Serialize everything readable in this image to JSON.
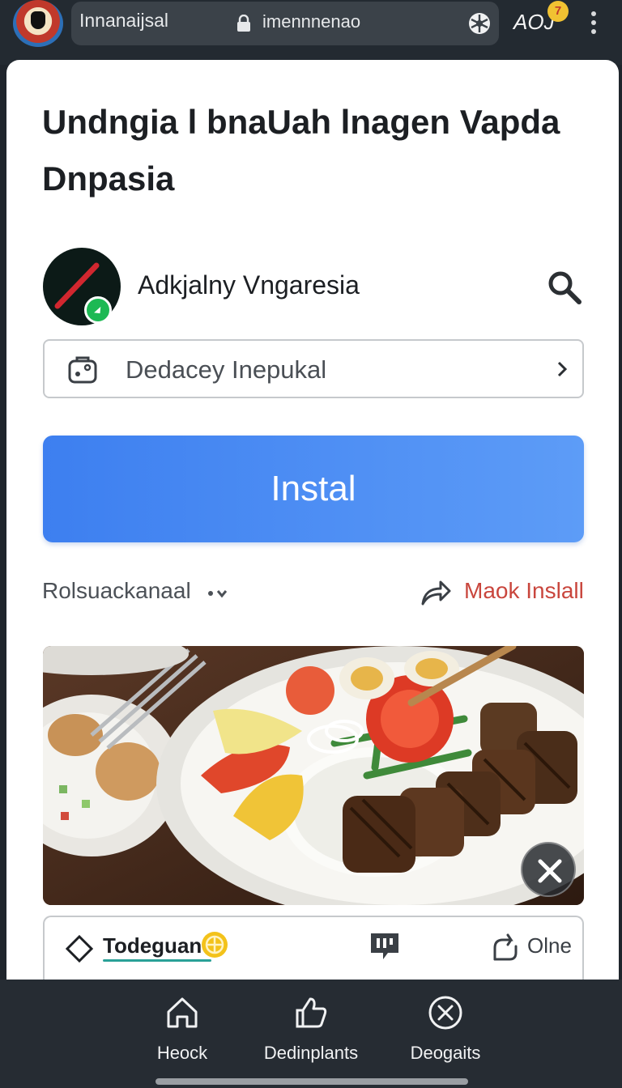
{
  "browser": {
    "tab_title": "Innanaijsal",
    "url": "imennnenao",
    "account_label": "AOJ",
    "account_badge": "7"
  },
  "page": {
    "title": "Undngia l bnaUah lnagen Vapda Dnpasia",
    "publisher": "Adkjalny Vngaresia",
    "detail_label": "Dedacey Inepukal",
    "install_label": "Instal",
    "more_label": "Rolsuackanaal",
    "share_label": "Maok Inslall"
  },
  "tabs": {
    "first_label": "Todeguan",
    "open_label": "Olne"
  },
  "bottom_nav": {
    "items": [
      {
        "label": "Heock",
        "icon": "home-icon"
      },
      {
        "label": "Dedinplants",
        "icon": "thumbs-up-icon"
      },
      {
        "label": "Deogaits",
        "icon": "close-circle-icon"
      }
    ]
  },
  "colors": {
    "install_blue": "#3d7ff0",
    "share_red": "#c9463d",
    "topbar": "#232a31",
    "accent_teal": "#2aa198"
  }
}
